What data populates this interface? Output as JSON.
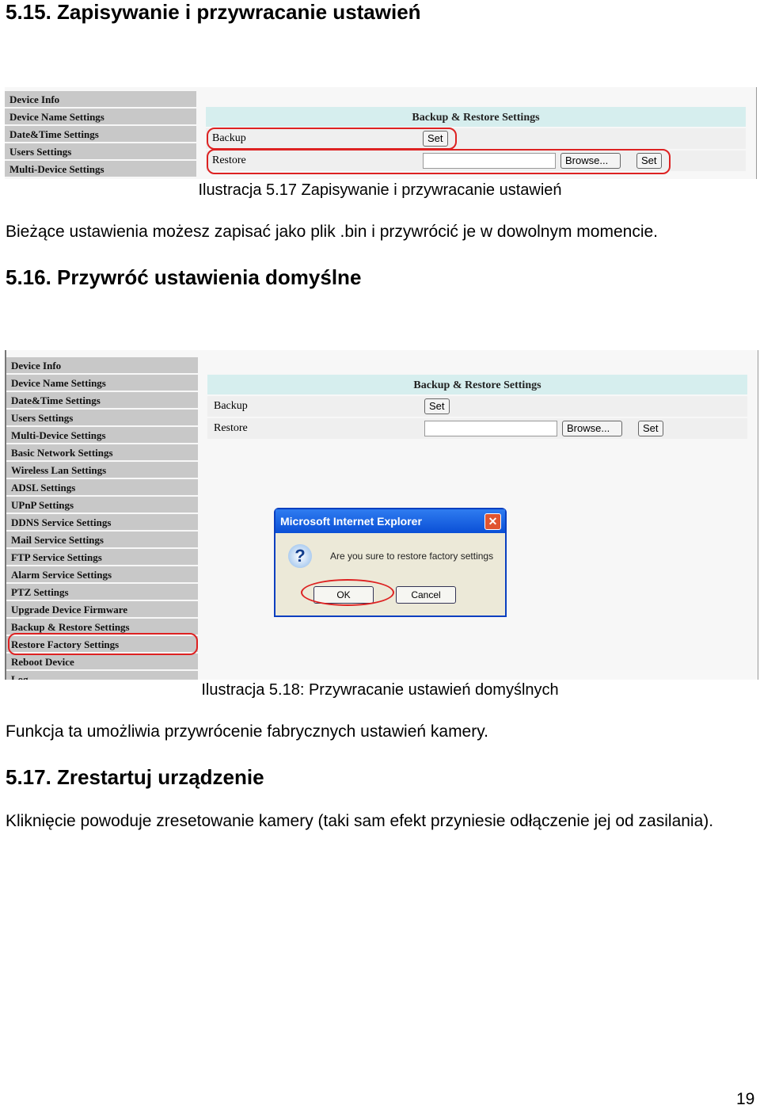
{
  "section1": {
    "title": "5.15. Zapisywanie i przywracanie ustawień",
    "caption": "Ilustracja 5.17 Zapisywanie i przywracanie ustawień",
    "text": "Bieżące ustawienia możesz zapisać jako plik .bin i przywrócić je w dowolnym momencie."
  },
  "section2": {
    "title": "5.16. Przywróć ustawienia domyślne",
    "caption": "Ilustracja 5.18: Przywracanie ustawień domyślnych",
    "text": "Funkcja ta umożliwia przywrócenie fabrycznych ustawień kamery."
  },
  "section3": {
    "title": "5.17. Zrestartuj urządzenie",
    "text": "Kliknięcie powoduje zresetowanie kamery (taki sam efekt przyniesie odłączenie jej od zasilania)."
  },
  "page_number": "19",
  "shot": {
    "menu": [
      "Device Info",
      "Device Name Settings",
      "Date&Time Settings",
      "Users Settings",
      "Multi-Device Settings",
      "Basic Network Settings",
      "Wireless Lan Settings",
      "ADSL Settings",
      "UPnP Settings",
      "DDNS Service Settings",
      "Mail Service Settings",
      "FTP Service Settings",
      "Alarm Service Settings",
      "PTZ Settings",
      "Upgrade Device Firmware",
      "Backup & Restore Settings",
      "Restore Factory Settings",
      "Reboot Device",
      "Log"
    ],
    "panel_title": "Backup & Restore Settings",
    "backup_label": "Backup",
    "restore_label": "Restore",
    "set": "Set",
    "browse": "Browse...",
    "dialog": {
      "title": "Microsoft Internet Explorer",
      "message": "Are you sure to restore factory settings",
      "ok": "OK",
      "cancel": "Cancel"
    }
  },
  "colors": {
    "highlight": "#dd2222",
    "panel_header": "#d6eeee",
    "dialog_title": "#0a4fd6"
  }
}
